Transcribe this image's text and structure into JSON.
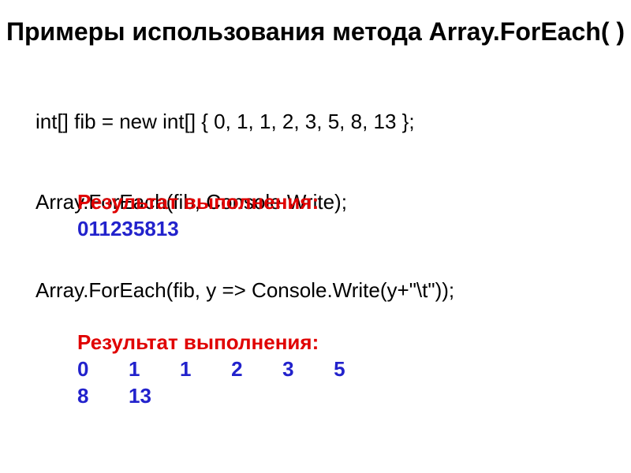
{
  "title": "Примеры использования метода Array.ForEach( )",
  "code1": "int[] fib = new int[] { 0, 1, 1, 2, 3, 5, 8, 13 };",
  "code2": "Array.ForEach(fib, Console.Write);",
  "result1": {
    "label": "Результат выполнения:",
    "output": "011235813"
  },
  "code3": "Array.ForEach(fib, y => Console.Write(y+\"\\t\"));",
  "result2": {
    "label": "Результат выполнения:",
    "output_line1": "0       1       1       2       3       5",
    "output_line2": "8       13"
  }
}
